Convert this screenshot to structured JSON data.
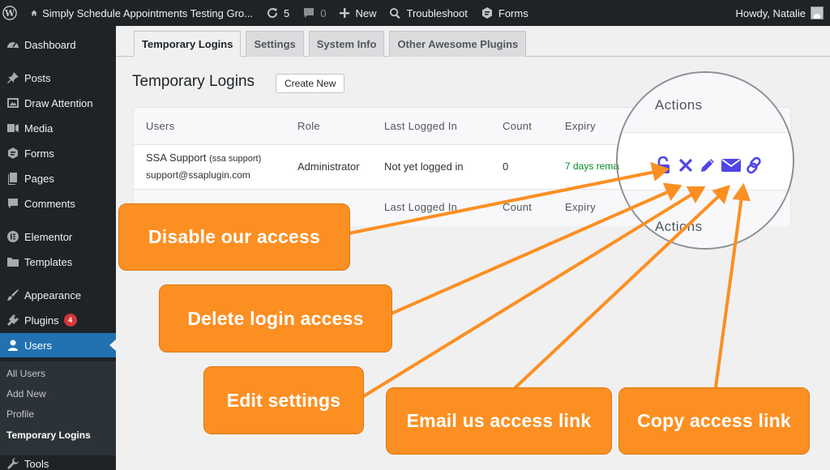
{
  "adminbar": {
    "site_name": "Simply Schedule Appointments Testing Gro...",
    "updates_count": "5",
    "comments_count": "0",
    "new_label": "New",
    "troubleshoot_label": "Troubleshoot",
    "forms_label": "Forms",
    "greeting": "Howdy, Natalie"
  },
  "sidebar": {
    "items": {
      "dashboard": "Dashboard",
      "posts": "Posts",
      "draw_attention": "Draw Attention",
      "media": "Media",
      "forms": "Forms",
      "pages": "Pages",
      "comments": "Comments",
      "elementor": "Elementor",
      "templates": "Templates",
      "appearance": "Appearance",
      "plugins": "Plugins",
      "plugins_badge": "4",
      "users": "Users",
      "tools": "Tools"
    },
    "submenu": {
      "all_users": "All Users",
      "add_new": "Add New",
      "profile": "Profile",
      "temporary_logins": "Temporary Logins"
    }
  },
  "tabs": {
    "temporary_logins": "Temporary Logins",
    "settings": "Settings",
    "system_info": "System Info",
    "other_plugins": "Other Awesome Plugins"
  },
  "page": {
    "title": "Temporary Logins",
    "create_new": "Create New"
  },
  "table": {
    "headers": {
      "users": "Users",
      "role": "Role",
      "last_logged_in": "Last Logged In",
      "count": "Count",
      "expiry": "Expiry",
      "actions": "Actions"
    },
    "row": {
      "name": "SSA Support",
      "username": "(ssa support)",
      "email": "support@ssaplugin.com",
      "role": "Administrator",
      "last_logged_in": "Not yet logged in",
      "count": "0",
      "expiry": "7 days rema"
    }
  },
  "callouts": {
    "disable": "Disable our access",
    "delete": "Delete login access",
    "edit": "Edit settings",
    "email": "Email us access link",
    "copy": "Copy access link"
  },
  "colors": {
    "accent": "#2271b1",
    "callout": "#fc8f22",
    "action_icons": "#4f46e5",
    "expiry_green": "#008a20"
  }
}
